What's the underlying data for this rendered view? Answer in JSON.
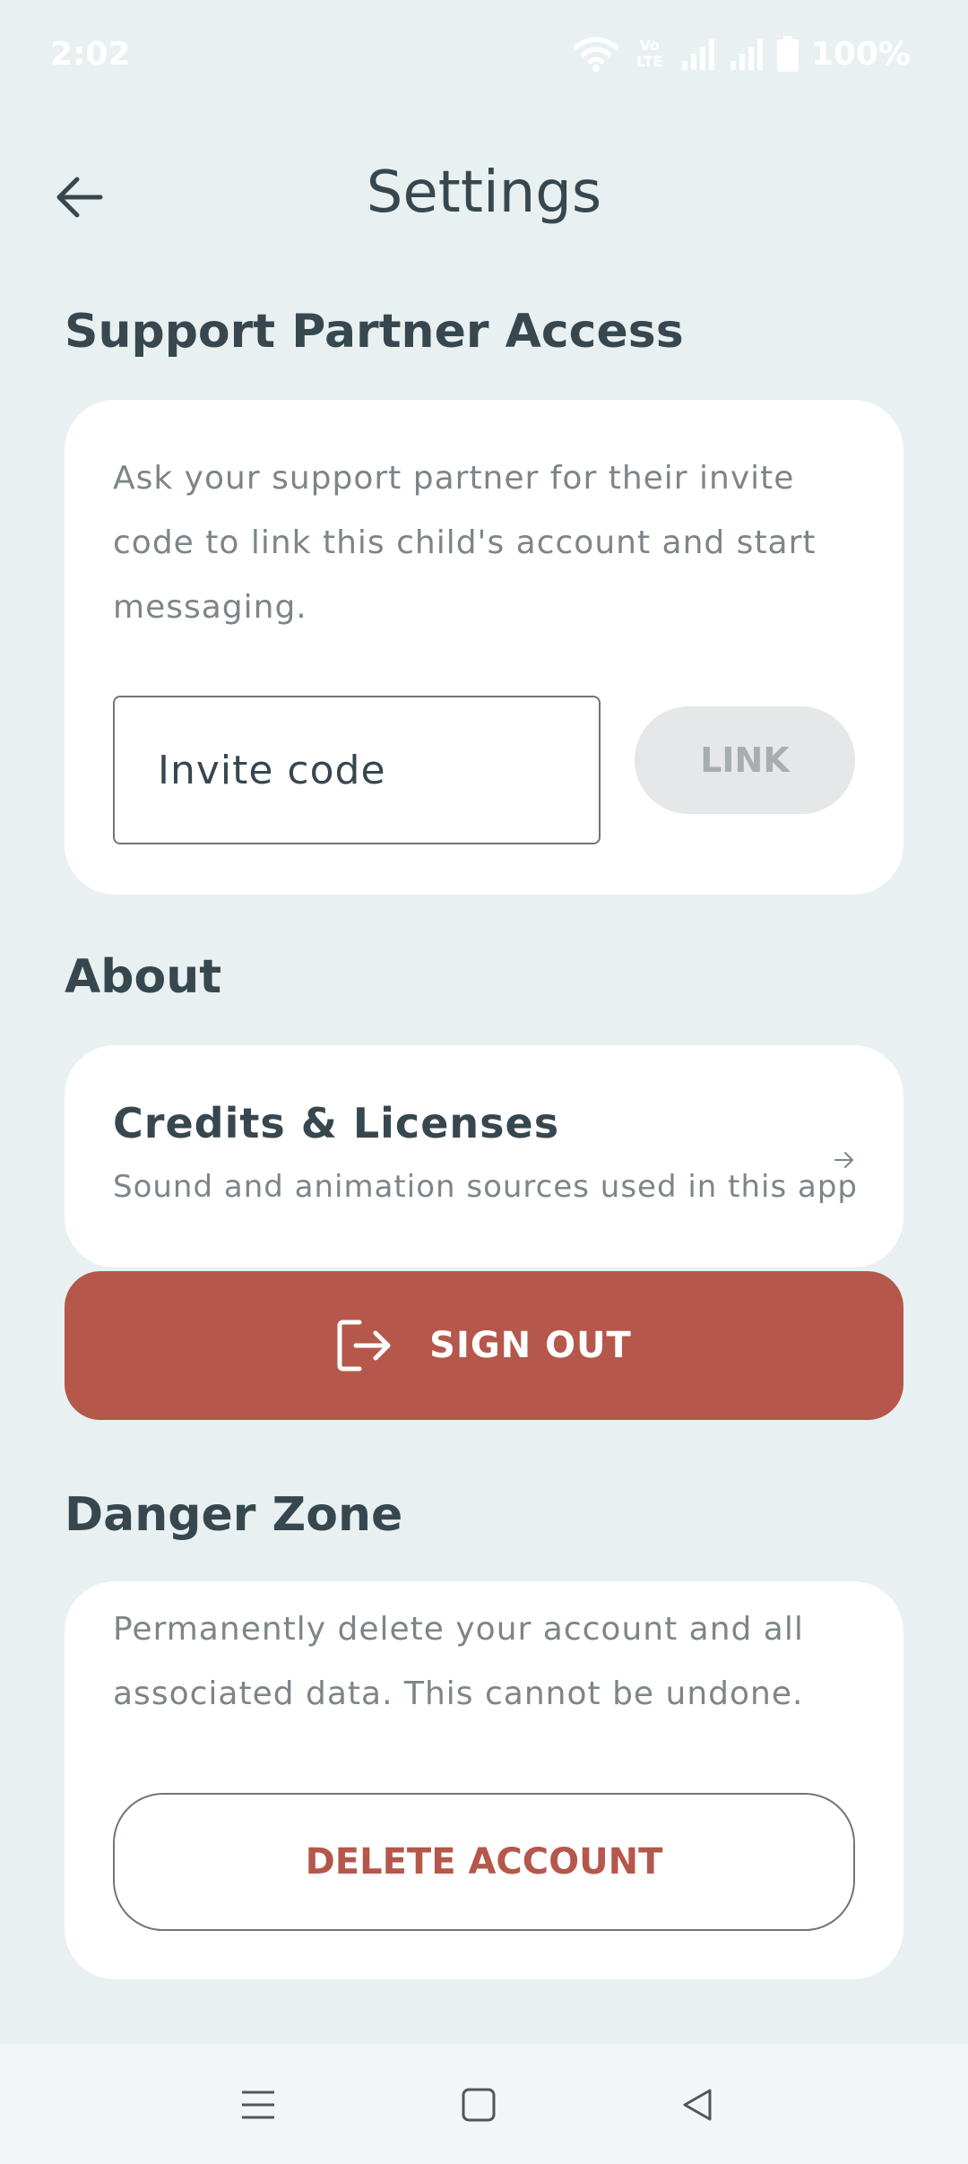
{
  "status_bar": {
    "time": "2:02",
    "volte_label": "Vo LTE",
    "battery_percent": "100%"
  },
  "header": {
    "title": "Settings",
    "back_icon": "arrow-left-icon"
  },
  "support_partner": {
    "section_title": "Support Partner Access",
    "description": "Ask your support partner for their invite code to link this child's account and start messaging.",
    "invite_placeholder": "Invite code",
    "invite_value": "",
    "link_label": "LINK"
  },
  "about": {
    "section_title": "About",
    "credits_title": "Credits & Licenses",
    "credits_subtitle": "Sound and animation sources used in this app",
    "arrow_icon": "arrow-right-icon"
  },
  "sign_out": {
    "label": "SIGN OUT",
    "icon": "logout-icon"
  },
  "danger_zone": {
    "section_title": "Danger Zone",
    "description": "Permanently delete your account and all associated data. This cannot be undone.",
    "delete_label": "DELETE ACCOUNT"
  },
  "colors": {
    "background": "#e8f0f1",
    "text_primary": "#37474f",
    "text_secondary": "#7d8589",
    "accent_red": "#b5574b",
    "card": "#ffffff"
  }
}
